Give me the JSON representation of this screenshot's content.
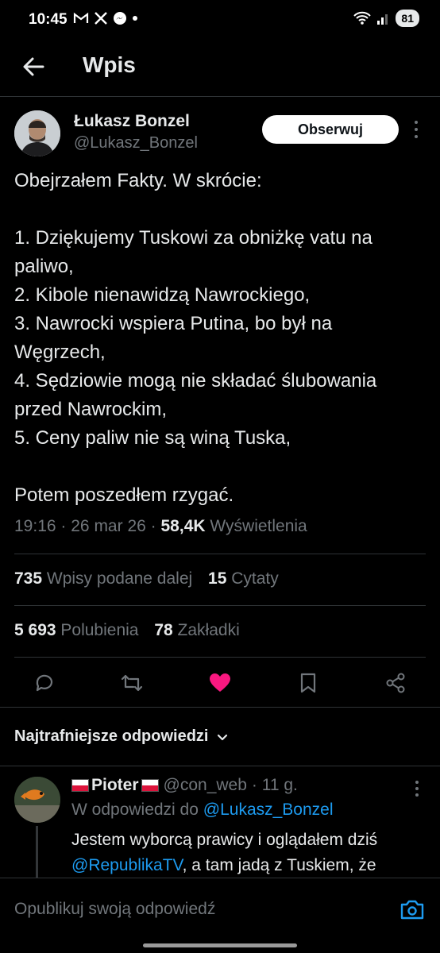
{
  "status_bar": {
    "time": "10:45",
    "battery": "81",
    "icons": [
      "gmail-icon",
      "x-icon",
      "messenger-icon",
      "dot-icon",
      "wifi-icon",
      "signal-icon"
    ]
  },
  "header": {
    "title": "Wpis"
  },
  "post": {
    "author_name": "Łukasz Bonzel",
    "author_handle": "@Lukasz_Bonzel",
    "follow_label": "Obserwuj",
    "lines": [
      "Obejrzałem Fakty. W skrócie:",
      "",
      "1. Dziękujemy Tuskowi za obniżkę vatu na paliwo,",
      "2. Kibole nienawidzą Nawrockiego,",
      "3. Nawrocki wspiera Putina, bo był na Węgrzech,",
      "4. Sędziowie mogą nie składać ślubowania przed Nawrockim,",
      "5. Ceny paliw nie są winą Tuska,",
      "",
      "Potem poszedłem rzygać."
    ],
    "time": "19:16",
    "date": "26 mar 26",
    "views_count": "58,4K",
    "views_label": "Wyświetlenia",
    "separator": "·"
  },
  "stats": {
    "reposts_count": "735",
    "reposts_label": "Wpisy podane dalej",
    "quotes_count": "15",
    "quotes_label": "Cytaty",
    "likes_count": "5 693",
    "likes_label": "Polubienia",
    "bookmarks_count": "78",
    "bookmarks_label": "Zakładki"
  },
  "actions": {
    "accent_like": "#f91880",
    "icons": [
      "reply-icon",
      "retweet-icon",
      "heart-icon",
      "bookmark-icon",
      "share-icon"
    ],
    "liked": true
  },
  "replies": {
    "section_title": "Najtrafniejsze odpowiedzi",
    "items": [
      {
        "name": "Pioter",
        "handle": "@con_web",
        "age": "· 11 g.",
        "reply_to_prefix": "W odpowiedzi do",
        "reply_to_handle": "@Lukasz_Bonzel",
        "text_line1": "Jestem wyborcą prawicy i oglądałem dziś",
        "mention": "@RepublikaTV",
        "text_line2_rest": ", a tam jadą z Tuskiem, że"
      }
    ]
  },
  "composer": {
    "placeholder": "Opublikuj swoją odpowiedź"
  },
  "colors": {
    "background": "#000000",
    "text": "#e7e9ea",
    "muted": "#71767b",
    "link": "#1d9bf0",
    "divider": "#2f3336"
  }
}
